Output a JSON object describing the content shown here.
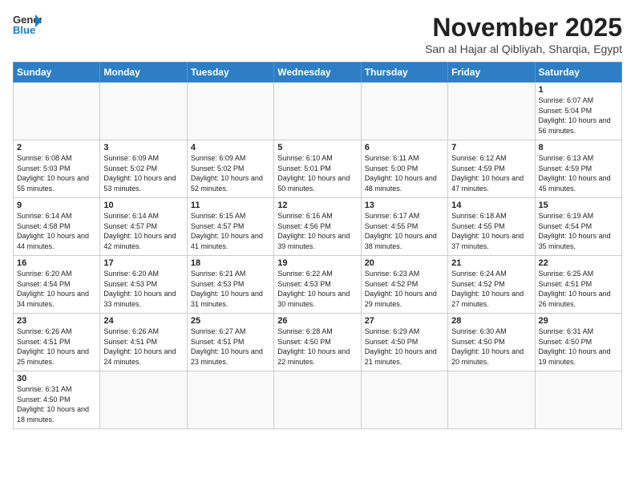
{
  "header": {
    "logo_general": "General",
    "logo_blue": "Blue",
    "month_title": "November 2025",
    "location": "San al Hajar al Qibliyah, Sharqia, Egypt"
  },
  "weekdays": [
    "Sunday",
    "Monday",
    "Tuesday",
    "Wednesday",
    "Thursday",
    "Friday",
    "Saturday"
  ],
  "weeks": [
    [
      {
        "day": "",
        "info": ""
      },
      {
        "day": "",
        "info": ""
      },
      {
        "day": "",
        "info": ""
      },
      {
        "day": "",
        "info": ""
      },
      {
        "day": "",
        "info": ""
      },
      {
        "day": "",
        "info": ""
      },
      {
        "day": "1",
        "info": "Sunrise: 6:07 AM\nSunset: 5:04 PM\nDaylight: 10 hours and 56 minutes."
      }
    ],
    [
      {
        "day": "2",
        "info": "Sunrise: 6:08 AM\nSunset: 5:03 PM\nDaylight: 10 hours and 55 minutes."
      },
      {
        "day": "3",
        "info": "Sunrise: 6:09 AM\nSunset: 5:02 PM\nDaylight: 10 hours and 53 minutes."
      },
      {
        "day": "4",
        "info": "Sunrise: 6:09 AM\nSunset: 5:02 PM\nDaylight: 10 hours and 52 minutes."
      },
      {
        "day": "5",
        "info": "Sunrise: 6:10 AM\nSunset: 5:01 PM\nDaylight: 10 hours and 50 minutes."
      },
      {
        "day": "6",
        "info": "Sunrise: 6:11 AM\nSunset: 5:00 PM\nDaylight: 10 hours and 48 minutes."
      },
      {
        "day": "7",
        "info": "Sunrise: 6:12 AM\nSunset: 4:59 PM\nDaylight: 10 hours and 47 minutes."
      },
      {
        "day": "8",
        "info": "Sunrise: 6:13 AM\nSunset: 4:59 PM\nDaylight: 10 hours and 45 minutes."
      }
    ],
    [
      {
        "day": "9",
        "info": "Sunrise: 6:14 AM\nSunset: 4:58 PM\nDaylight: 10 hours and 44 minutes."
      },
      {
        "day": "10",
        "info": "Sunrise: 6:14 AM\nSunset: 4:57 PM\nDaylight: 10 hours and 42 minutes."
      },
      {
        "day": "11",
        "info": "Sunrise: 6:15 AM\nSunset: 4:57 PM\nDaylight: 10 hours and 41 minutes."
      },
      {
        "day": "12",
        "info": "Sunrise: 6:16 AM\nSunset: 4:56 PM\nDaylight: 10 hours and 39 minutes."
      },
      {
        "day": "13",
        "info": "Sunrise: 6:17 AM\nSunset: 4:55 PM\nDaylight: 10 hours and 38 minutes."
      },
      {
        "day": "14",
        "info": "Sunrise: 6:18 AM\nSunset: 4:55 PM\nDaylight: 10 hours and 37 minutes."
      },
      {
        "day": "15",
        "info": "Sunrise: 6:19 AM\nSunset: 4:54 PM\nDaylight: 10 hours and 35 minutes."
      }
    ],
    [
      {
        "day": "16",
        "info": "Sunrise: 6:20 AM\nSunset: 4:54 PM\nDaylight: 10 hours and 34 minutes."
      },
      {
        "day": "17",
        "info": "Sunrise: 6:20 AM\nSunset: 4:53 PM\nDaylight: 10 hours and 33 minutes."
      },
      {
        "day": "18",
        "info": "Sunrise: 6:21 AM\nSunset: 4:53 PM\nDaylight: 10 hours and 31 minutes."
      },
      {
        "day": "19",
        "info": "Sunrise: 6:22 AM\nSunset: 4:53 PM\nDaylight: 10 hours and 30 minutes."
      },
      {
        "day": "20",
        "info": "Sunrise: 6:23 AM\nSunset: 4:52 PM\nDaylight: 10 hours and 29 minutes."
      },
      {
        "day": "21",
        "info": "Sunrise: 6:24 AM\nSunset: 4:52 PM\nDaylight: 10 hours and 27 minutes."
      },
      {
        "day": "22",
        "info": "Sunrise: 6:25 AM\nSunset: 4:51 PM\nDaylight: 10 hours and 26 minutes."
      }
    ],
    [
      {
        "day": "23",
        "info": "Sunrise: 6:26 AM\nSunset: 4:51 PM\nDaylight: 10 hours and 25 minutes."
      },
      {
        "day": "24",
        "info": "Sunrise: 6:26 AM\nSunset: 4:51 PM\nDaylight: 10 hours and 24 minutes."
      },
      {
        "day": "25",
        "info": "Sunrise: 6:27 AM\nSunset: 4:51 PM\nDaylight: 10 hours and 23 minutes."
      },
      {
        "day": "26",
        "info": "Sunrise: 6:28 AM\nSunset: 4:50 PM\nDaylight: 10 hours and 22 minutes."
      },
      {
        "day": "27",
        "info": "Sunrise: 6:29 AM\nSunset: 4:50 PM\nDaylight: 10 hours and 21 minutes."
      },
      {
        "day": "28",
        "info": "Sunrise: 6:30 AM\nSunset: 4:50 PM\nDaylight: 10 hours and 20 minutes."
      },
      {
        "day": "29",
        "info": "Sunrise: 6:31 AM\nSunset: 4:50 PM\nDaylight: 10 hours and 19 minutes."
      }
    ],
    [
      {
        "day": "30",
        "info": "Sunrise: 6:31 AM\nSunset: 4:50 PM\nDaylight: 10 hours and 18 minutes."
      },
      {
        "day": "",
        "info": ""
      },
      {
        "day": "",
        "info": ""
      },
      {
        "day": "",
        "info": ""
      },
      {
        "day": "",
        "info": ""
      },
      {
        "day": "",
        "info": ""
      },
      {
        "day": "",
        "info": ""
      }
    ]
  ]
}
